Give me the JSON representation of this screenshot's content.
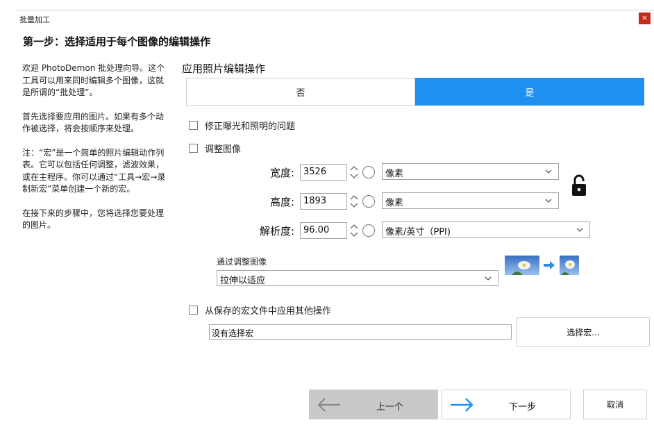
{
  "window": {
    "title": "批量加工",
    "close_glyph": "×"
  },
  "step_title": "第一步：选择适用于每个图像的编辑操作",
  "description": [
    "欢迎 PhotoDemon 批处理向导。这个工具可以用来同时编辑多个图像，这就是所谓的“批处理”。",
    "首先选择要应用的图片。如果有多个动作被选择，将会按顺序来处理。",
    "注：“宏”是一个简单的照片编辑动作列表。它可以包括任何调整，滤波效果，或在主程序。你可以通过“工具→宏→录制新宏”菜单创建一个新的宏。",
    "在接下来的步骤中，您将选择您要处理的图片。"
  ],
  "section_title": "应用照片编辑操作",
  "toggle": {
    "no": "否",
    "yes": "是",
    "selected": "yes"
  },
  "colors": {
    "accent": "#1e90f0",
    "close": "#c42b1c"
  },
  "options": {
    "exposure": {
      "label": "修正曝光和照明的问题",
      "checked": false
    },
    "resize": {
      "label": "调整图像",
      "checked": false
    },
    "macro": {
      "label": "从保存的宏文件中应用其他操作",
      "checked": false
    }
  },
  "resize": {
    "width": {
      "label": "宽度:",
      "value": "3526",
      "unit": "像素"
    },
    "height": {
      "label": "高度:",
      "value": "1893",
      "unit": "像素"
    },
    "resolution": {
      "label": "解析度:",
      "value": "96.00",
      "unit": "像素/英寸（PPI)"
    },
    "aspect_lock": "unlocked-lock-icon",
    "mode_label": "通过调整图像",
    "mode_value": "拉伸以适应"
  },
  "macro": {
    "path": "没有选择宏",
    "button": "选择宏..."
  },
  "nav": {
    "prev": "上一个",
    "next": "下一步",
    "cancel": "取消"
  }
}
